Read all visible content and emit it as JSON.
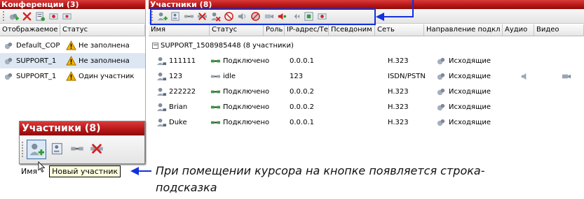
{
  "conferences_panel": {
    "title": "Конференции (3)",
    "columns": [
      "Отображаемое",
      "Статус"
    ],
    "rows": [
      {
        "name": "Default_COP",
        "status": "Не заполнена"
      },
      {
        "name": "SUPPORT_1",
        "status": "Не заполнена"
      },
      {
        "name": "SUPPORT_1",
        "status": "Один участник"
      }
    ]
  },
  "participants_panel": {
    "title": "Участники (8)",
    "columns": [
      "Имя",
      "Статус",
      "Роль",
      "IP-адрес/Те",
      "Псевдоним",
      "Сеть",
      "Направление подкл",
      "Аудио",
      "Видео"
    ],
    "group_label": "SUPPORT_1508985448 (8 участники)",
    "rows": [
      {
        "name": "111111",
        "status": "Подключено",
        "ip": "0.0.0.1",
        "network": "H.323",
        "direction": "Исходящие",
        "audio": false,
        "video": false
      },
      {
        "name": "123",
        "status": "idle",
        "ip": "123",
        "network": "ISDN/PSTN",
        "direction": "Исходящие",
        "audio": true,
        "video": true
      },
      {
        "name": "222222",
        "status": "Подключено",
        "ip": "0.0.0.2",
        "network": "H.323",
        "direction": "Исходящие",
        "audio": false,
        "video": false
      },
      {
        "name": "Brian",
        "status": "Подключено",
        "ip": "0.0.0.2",
        "network": "H.323",
        "direction": "Исходящие",
        "audio": false,
        "video": false
      },
      {
        "name": "Duke",
        "status": "Подключено",
        "ip": "0.0.0.1",
        "network": "H.323",
        "direction": "Исходящие",
        "audio": false,
        "video": false
      }
    ]
  },
  "zoom_callout": {
    "title": "Участники (8)",
    "name_label": "Имя",
    "tooltip": "Новый участник"
  },
  "annotation": {
    "line1": "При помещении курсора на кнопке появляется строка-",
    "line2": "подсказка"
  },
  "colors": {
    "title_red": "#c41f1f",
    "highlight_blue": "#1230e0",
    "selected_row": "#dde7f3"
  }
}
